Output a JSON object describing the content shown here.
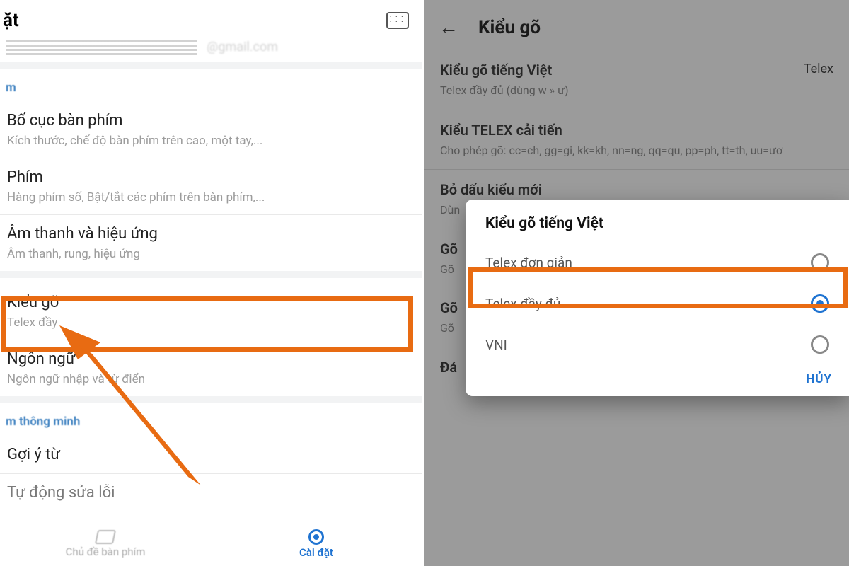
{
  "colors": {
    "accent": "#1f73d1",
    "highlight": "#e86b12"
  },
  "left": {
    "header_title": "ặt",
    "section_a_label": "m",
    "items": [
      {
        "title": "Bố cục bàn phím",
        "sub": "Kích thước, chế độ bàn phím trên cao, một tay,..."
      },
      {
        "title": "Phím",
        "sub": "Hàng phím số, Bật/tắt các phím trên bàn phím,..."
      },
      {
        "title": "Âm thanh và hiệu ứng",
        "sub": "Âm thanh, rung, hiệu ứng"
      }
    ],
    "group_b": [
      {
        "title": "Kiểu gõ",
        "sub": "Telex đầy"
      },
      {
        "title": "Ngôn ngữ",
        "sub": "Ngôn ngữ nhập và từ điển"
      }
    ],
    "section_b_label": "m thông minh",
    "group_c": [
      {
        "title": "Gợi ý từ",
        "sub": ""
      },
      {
        "title": "Tự động sửa lỗi",
        "sub": ""
      }
    ],
    "bottom_nav": {
      "themes": "Chủ đề bàn phím",
      "settings": "Cài đặt"
    }
  },
  "right": {
    "title": "Kiểu gõ",
    "rows": [
      {
        "title": "Kiểu gõ tiếng Việt",
        "sub": "Telex đầy đủ (dùng w » ư)",
        "value": "Telex"
      },
      {
        "title": "Kiểu TELEX cải tiến",
        "sub": "Cho phép gõ: cc=ch, gg=gi, kk=kh, nn=ng, qq=qu, pp=ph, tt=th, uu=ươ"
      },
      {
        "title": "Bỏ dấu kiểu mới",
        "sub": "Dùn"
      },
      {
        "title": "Gõ",
        "sub": "Gõ"
      },
      {
        "title": "Gõ",
        "sub": "Gõ"
      },
      {
        "title": "Đá",
        "sub": ""
      }
    ],
    "dialog": {
      "title": "Kiểu gõ tiếng Việt",
      "options": [
        "Telex đơn giản",
        "Telex đầy đủ",
        "VNI"
      ],
      "selected_index": 1,
      "cancel": "HỦY"
    }
  }
}
